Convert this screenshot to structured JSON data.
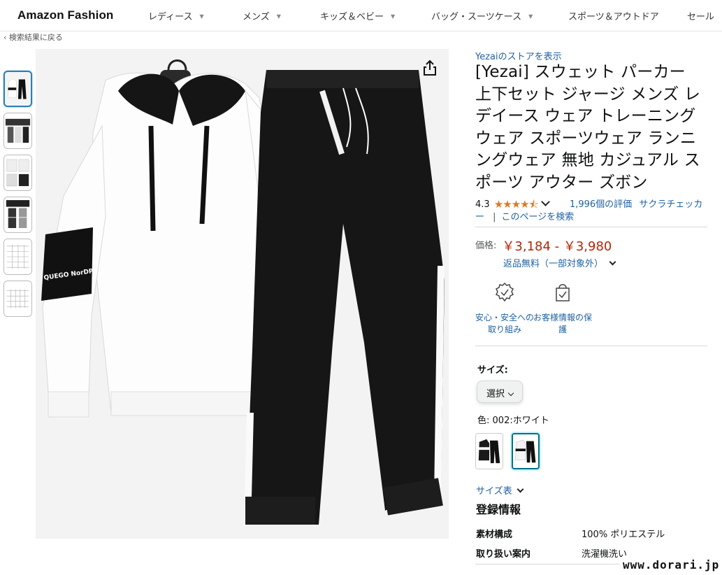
{
  "nav": {
    "brand": "Amazon Fashion",
    "items": [
      {
        "label": "レディース"
      },
      {
        "label": "メンズ"
      },
      {
        "label": "キッズ＆ベビー"
      },
      {
        "label": "バッグ・スーツケース"
      },
      {
        "label": "スポーツ＆アウトドア"
      },
      {
        "label": "セール"
      }
    ]
  },
  "back_link": "‹ 検索結果に戻る",
  "gallery": {
    "thumbnail_count": 6,
    "selected_index": 0,
    "share_icon": "share-icon"
  },
  "product": {
    "store_link": "Yezaiのストアを表示",
    "title": "[Yezai] スウェット パーカー 上下セット ジャージ メンズ レデイース ウェア トレーニングウェア スポーツウェア ランニングウェア 無地 カジュアル スポーツ アウター ズボン",
    "rating": "4.3",
    "stars": 4.3,
    "ratings_count": "1,996個の評価",
    "sakura_link": "サクラチェッカー",
    "separator": "|",
    "search_link": "このページを検索",
    "price_label": "価格:",
    "price": "￥3,184 - ￥3,980",
    "returns": "返品無料（一部対象外）",
    "trust": [
      {
        "label": "安心・安全への取り組み",
        "icon": "shield-badge-icon"
      },
      {
        "label": "お客様情報の保護",
        "icon": "secure-bag-icon"
      }
    ],
    "size_label": "サイズ:",
    "size_select": "選択",
    "color_label": "色:",
    "color_value": "002:ホワイト",
    "size_chart": "サイズ表",
    "registration_title": "登録情報",
    "specs": [
      {
        "key": "素材構成",
        "value": "100% ポリエステル"
      },
      {
        "key": "取り扱い案内",
        "value": "洗濯機洗い"
      }
    ]
  },
  "watermark": "www.dorari.jp",
  "colors": {
    "link": "#2162a1",
    "price": "#b12704",
    "star": "#de7921",
    "selected_thumb": "#2d7fb4",
    "selected_swatch": "#007185"
  }
}
